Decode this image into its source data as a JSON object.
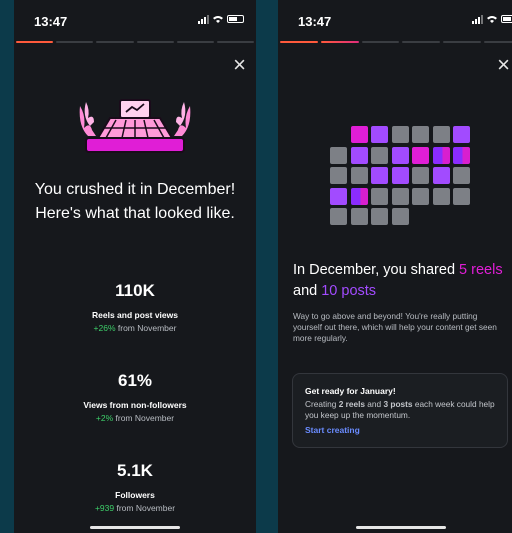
{
  "left": {
    "time": "13:47",
    "close": "×",
    "headline": "You crushed it in December! Here's what that looked like.",
    "stats": [
      {
        "value": "110K",
        "label": "Reels and post views",
        "change": "+26%",
        "suffix": "from November"
      },
      {
        "value": "61%",
        "label": "Views from non-followers",
        "change": "+2%",
        "suffix": "from November"
      },
      {
        "value": "5.1K",
        "label": "Followers",
        "change": "+939",
        "suffix": "from November"
      }
    ]
  },
  "right": {
    "time": "13:47",
    "close": "×",
    "title_pre": "In December, you shared",
    "reels_count": "5",
    "reels_word": "reels",
    "and_word": "and",
    "posts_count": "10 posts",
    "description": "Way to go above and beyond! You're really putting yourself out there, which will help your content get seen more regularly.",
    "card": {
      "title": "Get ready for January!",
      "text_pre": "Creating",
      "reels": "2 reels",
      "and_word": "and",
      "posts": "3 posts",
      "text_post": "each week could help you keep up the momentum.",
      "link": "Start creating"
    }
  },
  "colors": {
    "positive": "#3ecf6a",
    "reel": "#e01ed6",
    "post": "#a24bff",
    "link": "#6a8cff"
  },
  "calendar": {
    "rows": [
      [
        "empty",
        "reel",
        "post",
        "none",
        "none",
        "none",
        "post"
      ],
      [
        "none",
        "post",
        "none",
        "post",
        "reel",
        "split",
        "split"
      ],
      [
        "none",
        "none",
        "post",
        "post",
        "none",
        "post",
        "none"
      ],
      [
        "post",
        "split",
        "none",
        "none",
        "none",
        "none",
        "none"
      ],
      [
        "none",
        "none",
        "none",
        "none"
      ]
    ]
  }
}
